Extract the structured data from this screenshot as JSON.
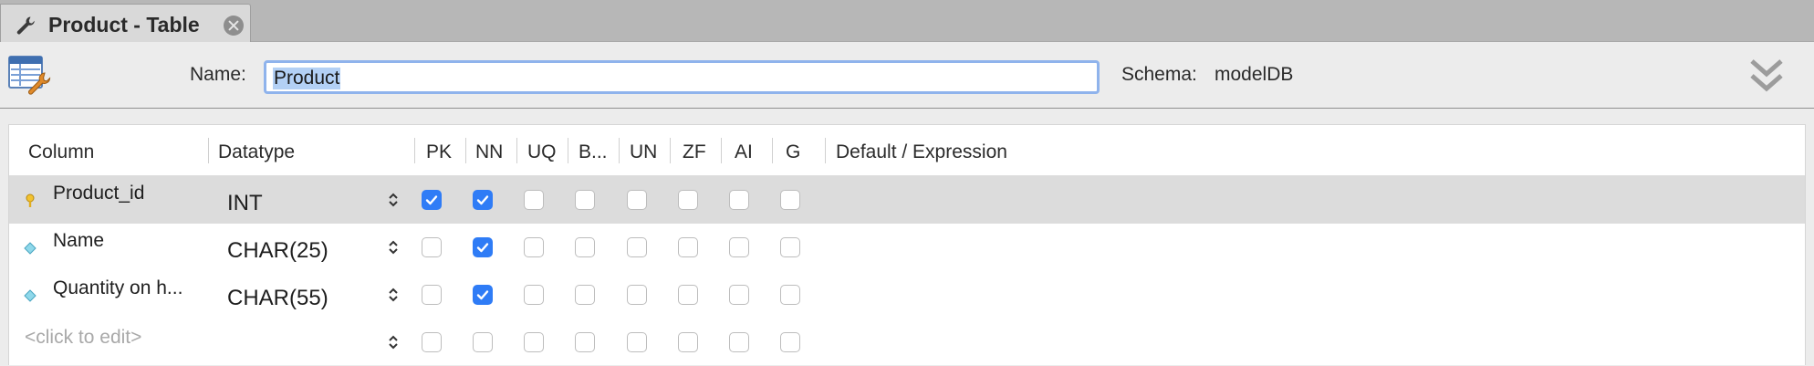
{
  "tab": {
    "title": "Product - Table"
  },
  "header": {
    "name_label": "Name:",
    "name_value": "Product",
    "schema_label": "Schema:",
    "schema_value": "modelDB"
  },
  "grid": {
    "headers": {
      "column": "Column",
      "datatype": "Datatype",
      "pk": "PK",
      "nn": "NN",
      "uq": "UQ",
      "b": "B...",
      "un": "UN",
      "zf": "ZF",
      "ai": "AI",
      "g": "G",
      "default": "Default / Expression"
    },
    "rows": [
      {
        "name": "Product_id",
        "datatype": "INT",
        "icon": "primary-key-icon",
        "pk": true,
        "nn": true,
        "uq": false,
        "b": false,
        "un": false,
        "zf": false,
        "ai": false,
        "g": false
      },
      {
        "name": "Name",
        "datatype": "CHAR(25)",
        "icon": "column-diamond-icon",
        "pk": false,
        "nn": true,
        "uq": false,
        "b": false,
        "un": false,
        "zf": false,
        "ai": false,
        "g": false
      },
      {
        "name": "Quantity on h...",
        "datatype": "CHAR(55)",
        "icon": "column-diamond-icon",
        "pk": false,
        "nn": true,
        "uq": false,
        "b": false,
        "un": false,
        "zf": false,
        "ai": false,
        "g": false
      },
      {
        "name": "<click to edit>",
        "datatype": "",
        "icon": "",
        "pk": false,
        "nn": false,
        "uq": false,
        "b": false,
        "un": false,
        "zf": false,
        "ai": false,
        "g": false
      }
    ]
  },
  "colors": {
    "accent": "#2f7cf6",
    "selected_row": "#dcdcdc",
    "focus_ring": "#8fb3ec"
  }
}
